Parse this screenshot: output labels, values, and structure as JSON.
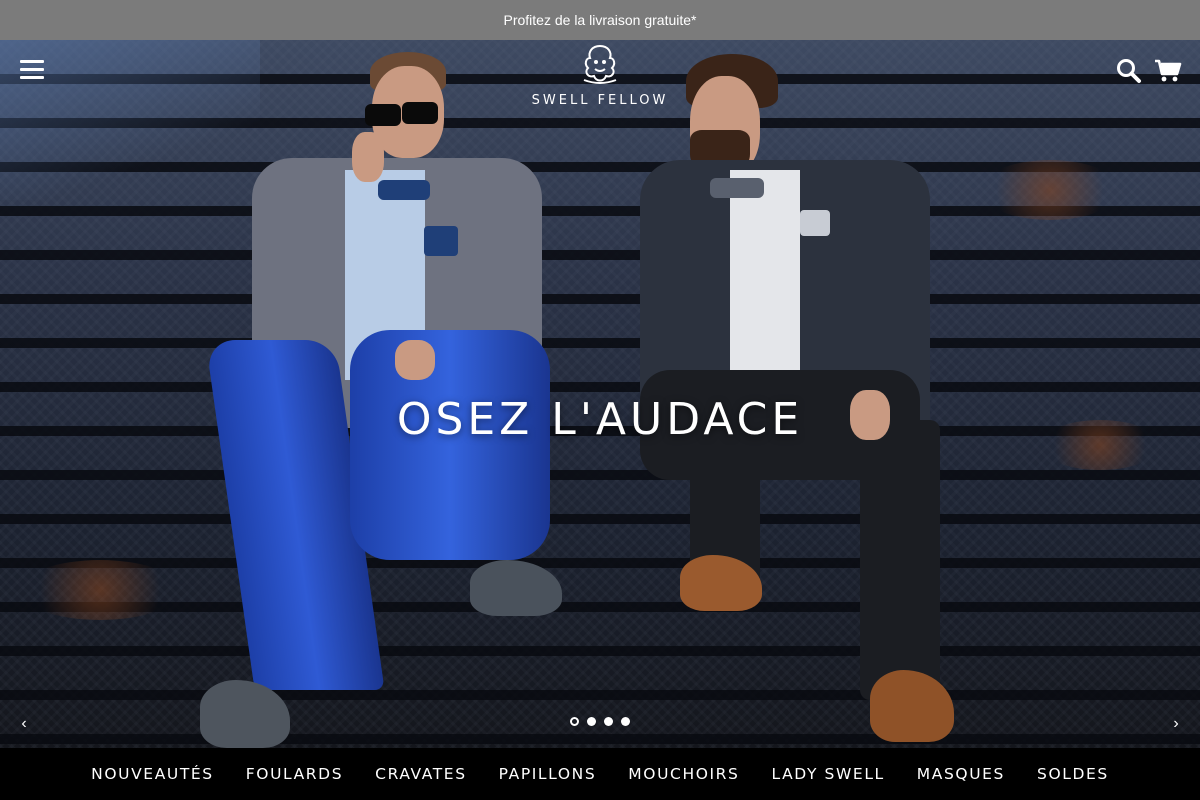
{
  "announcement": {
    "text": "Profitez de la livraison gratuite*"
  },
  "header": {
    "brand": "SWELL FELLOW",
    "icons": {
      "menu": "hamburger-menu-icon",
      "search": "search-icon",
      "cart": "cart-icon"
    }
  },
  "hero": {
    "headline": "OSEZ L'AUDACE",
    "slide_count": 4,
    "active_slide": 1,
    "prev_arrow": "‹",
    "next_arrow": "›"
  },
  "nav": {
    "items": [
      {
        "label": "NOUVEAUTÉS"
      },
      {
        "label": "FOULARDS"
      },
      {
        "label": "CRAVATES"
      },
      {
        "label": "PAPILLONS"
      },
      {
        "label": "MOUCHOIRS"
      },
      {
        "label": "LADY SWELL"
      },
      {
        "label": "MASQUES"
      },
      {
        "label": "SOLDES"
      }
    ]
  },
  "colors": {
    "announcement_bg": "#7b7b7b",
    "nav_bg": "#000000",
    "text": "#ffffff"
  }
}
